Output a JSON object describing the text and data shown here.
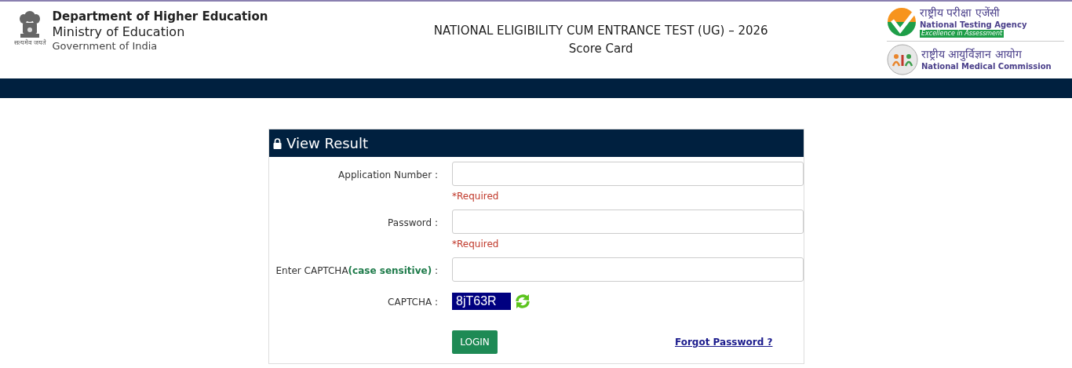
{
  "header": {
    "emblem_motto": "सत्यमेव जयते",
    "department": "Department of Higher Education",
    "ministry": "Ministry of Education",
    "government": "Government of India",
    "title": "NATIONAL ELIGIBILITY CUM ENTRANCE TEST (UG) – 2026",
    "subtitle": "Score Card",
    "nta": {
      "hindi": "राष्ट्रीय परीक्षा एजेंसी",
      "english": "National Testing Agency",
      "tagline": "Excellence in Assessment"
    },
    "nmc": {
      "hindi": "राष्ट्रीय आयुर्विज्ञान आयोग",
      "english": "National Medical Commission"
    }
  },
  "panel": {
    "title": "View Result",
    "fields": [
      {
        "kind": "input",
        "label": "Application Number :",
        "error": "*Required"
      },
      {
        "kind": "input",
        "label": "Password :",
        "error": "*Required"
      },
      {
        "kind": "input",
        "label": "Enter CAPTCHA**(case sensitive)** :"
      },
      {
        "kind": "captcha",
        "label": "CAPTCHA :",
        "code": "8jT63R"
      }
    ],
    "login": "LOGIN",
    "forgot": "Forgot Password ?"
  }
}
